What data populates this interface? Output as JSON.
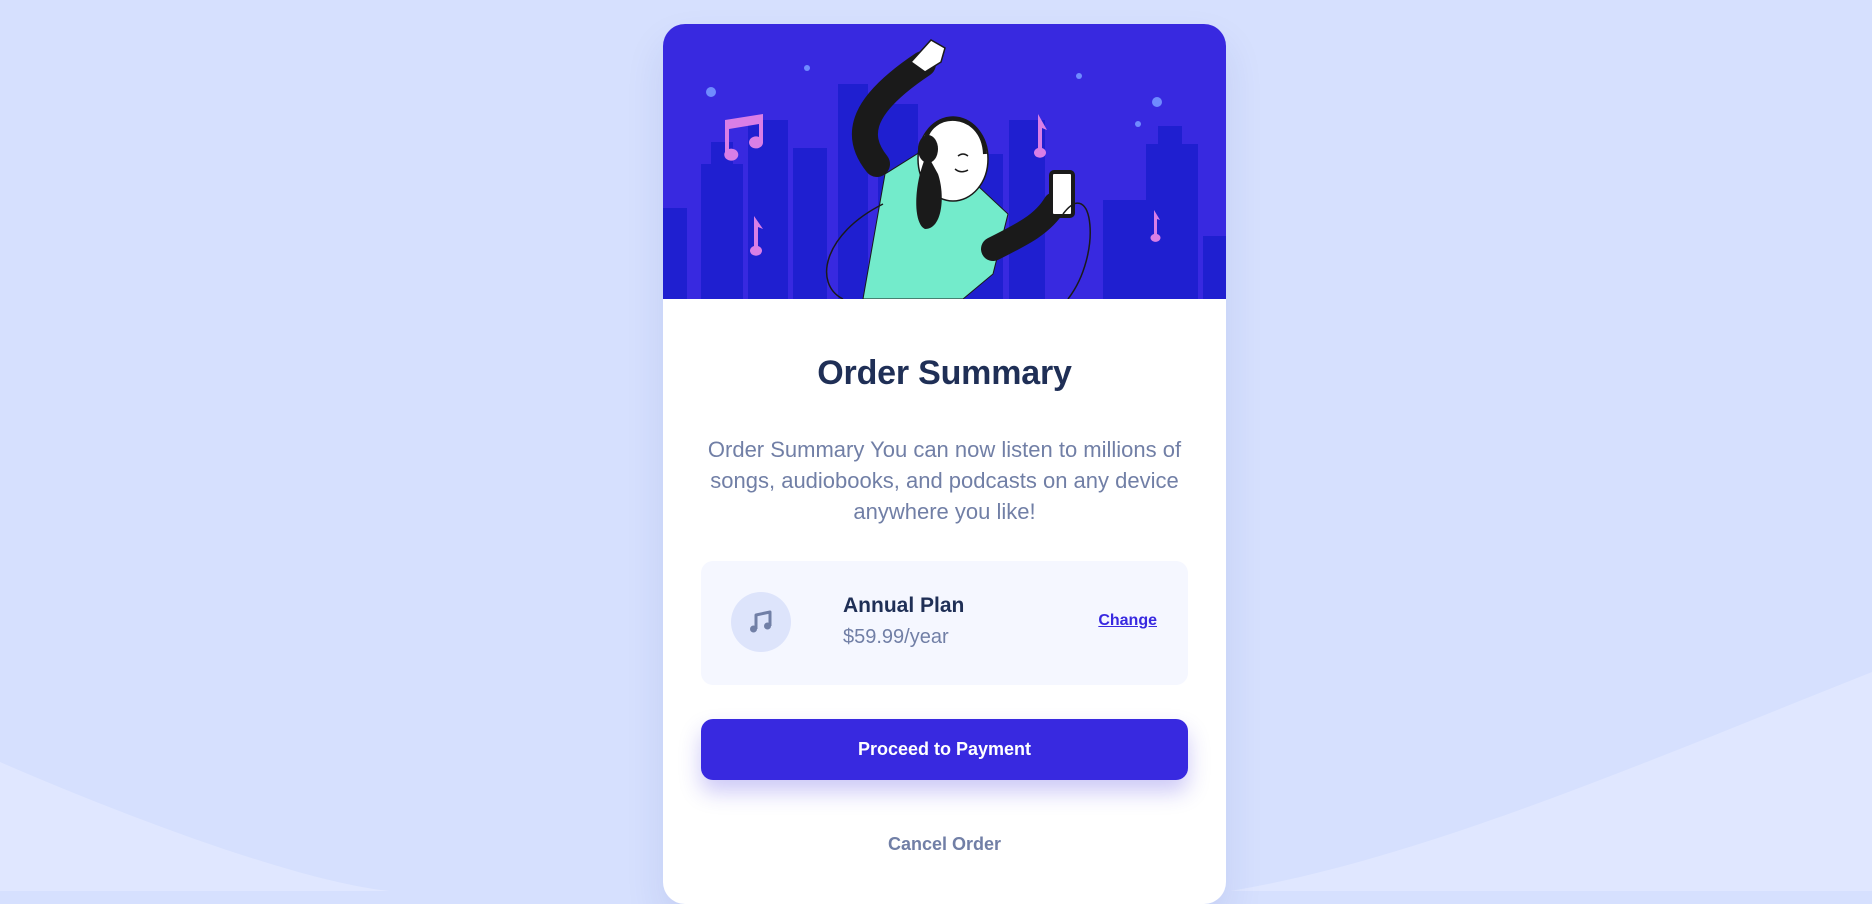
{
  "colors": {
    "page_background": "#d6e0fe",
    "hero_background": "#3829e0",
    "accent": "#3829e0",
    "heading": "#1f2f56",
    "body_text": "#717fa6",
    "plan_background": "#f5f7ff"
  },
  "hero": {
    "illustration": "woman-dancing-with-headphones-and-phone"
  },
  "order": {
    "title": "Order Summary",
    "description": "Order Summary You can now listen to millions of songs, audiobooks, and podcasts on any device anywhere you like!"
  },
  "plan": {
    "icon": "music-note-icon",
    "name": "Annual Plan",
    "price": "$59.99/year",
    "change_label": "Change"
  },
  "actions": {
    "pay_label": "Proceed to Payment",
    "cancel_label": "Cancel Order"
  }
}
